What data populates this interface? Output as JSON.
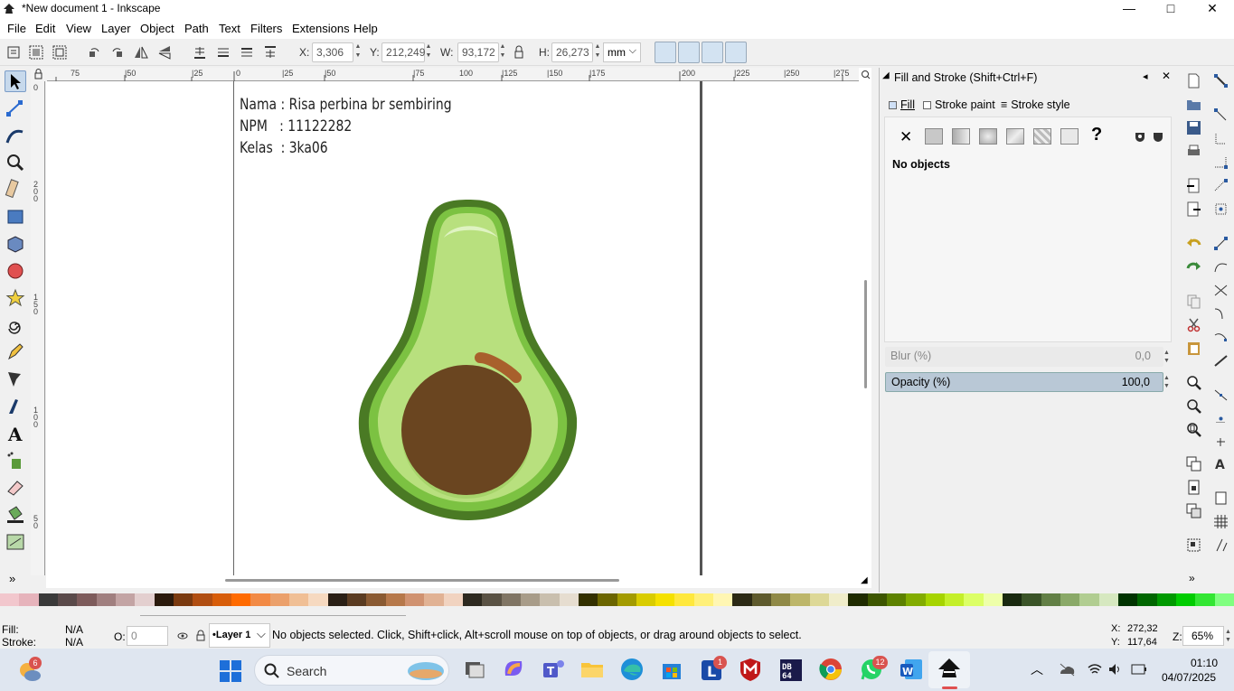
{
  "window": {
    "title": "*New document 1 - Inkscape",
    "minimize": "—",
    "maximize": "□",
    "close": "✕"
  },
  "menu": [
    "File",
    "Edit",
    "View",
    "Layer",
    "Object",
    "Path",
    "Text",
    "Filters",
    "Extensions",
    "Help"
  ],
  "toolbar": {
    "x_label": "X:",
    "x_value": "3,306",
    "y_label": "Y:",
    "y_value": "212,249",
    "w_label": "W:",
    "w_value": "93,172",
    "h_label": "H:",
    "h_value": "26,273",
    "unit": "mm"
  },
  "ruler_top": [
    "75",
    "|50",
    "|25",
    "0",
    "|25",
    "|50",
    "|75",
    "100",
    "|125",
    "|150",
    "|175",
    "200",
    "|225",
    "|250",
    "|275"
  ],
  "ruler_left": [
    "0",
    "2\n0\n0",
    "1\n5\n0",
    "1\n0\n0",
    "5\n0"
  ],
  "document": {
    "lines": [
      "Nama : Risa perbina br sembiring",
      "NPM   : 11122282",
      "Kelas  : 3ka06"
    ]
  },
  "dialog": {
    "title": "Fill and Stroke (Shift+Ctrl+F)",
    "tabs": [
      "Fill",
      "Stroke paint",
      "Stroke style"
    ],
    "no_objects": "No objects",
    "blur_label": "Blur (%)",
    "blur_value": "0,0",
    "opacity_label": "Opacity (%)",
    "opacity_value": "100,0"
  },
  "palette": [
    "#f2c7cd",
    "#e6b3bb",
    "#3a3a3a",
    "#5a4a4a",
    "#7d5b5b",
    "#a07f7f",
    "#c3a4a4",
    "#e3cfcf",
    "#2b1a0c",
    "#7a3a10",
    "#b04e12",
    "#d75d0a",
    "#ff6a00",
    "#f28a45",
    "#eba06b",
    "#f0bf95",
    "#f6d9c0",
    "#2a1f15",
    "#5a3b21",
    "#8a5a32",
    "#b6784a",
    "#d09270",
    "#e1b294",
    "#f1d3c0",
    "#2e2a20",
    "#5a5244",
    "#807564",
    "#a89c89",
    "#c9bfae",
    "#e6ddd0",
    "#333000",
    "#6b6500",
    "#a39b00",
    "#d9cc00",
    "#f5e100",
    "#ffe83d",
    "#fff07a",
    "#fff6b3",
    "#2c2a15",
    "#5e5a2d",
    "#908a47",
    "#bdb66a",
    "#ddd897",
    "#f0edca",
    "#1f2b00",
    "#3d5600",
    "#5d8100",
    "#82ac00",
    "#a6d400",
    "#c4ef2a",
    "#dcff66",
    "#eeffaa",
    "#1a2a10",
    "#3b5428",
    "#627f45",
    "#8aa968",
    "#b1cd91",
    "#d6e8c0",
    "#003300",
    "#006600",
    "#009900",
    "#00cc00",
    "#33e633",
    "#80ff80"
  ],
  "status": {
    "fill_label": "Fill:",
    "fill_value": "N/A",
    "stroke_label": "Stroke:",
    "stroke_value": "N/A",
    "opacity_label": "O:",
    "opacity_value": "0",
    "layer": "•Layer 1",
    "message": "No objects selected. Click, Shift+click, Alt+scroll mouse on top of objects, or drag around objects to select.",
    "x_label": "X:",
    "x_value": "272,32",
    "y_label": "Y:",
    "y_value": "117,64",
    "z_label": "Z:",
    "zoom": "65%"
  },
  "taskbar": {
    "search": "Search",
    "time": "01:10",
    "date": "04/07/2025",
    "badge_weather": "6",
    "badge_l": "1",
    "badge_whatsapp": "12"
  }
}
